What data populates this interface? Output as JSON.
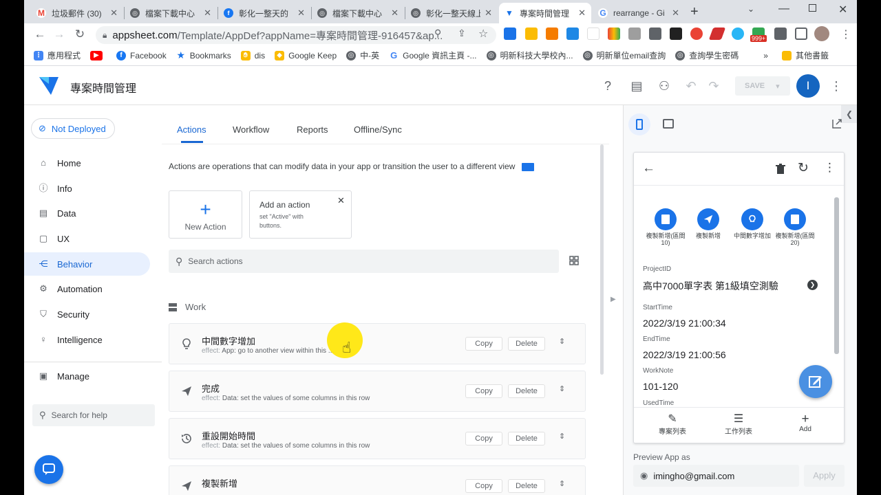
{
  "browser": {
    "tabs": [
      {
        "title": "垃圾郵件 (30)",
        "icon": "gmail-icon",
        "color": "#ea4335",
        "glyph": "M"
      },
      {
        "title": "檔案下載中心",
        "icon": "globe-icon",
        "color": "#5f6368",
        "glyph": "◎"
      },
      {
        "title": "彰化一整天的",
        "icon": "facebook-icon",
        "color": "#1877f2",
        "glyph": "f"
      },
      {
        "title": "檔案下載中心",
        "icon": "globe-icon",
        "color": "#5f6368",
        "glyph": "◎"
      },
      {
        "title": "彰化一整天線上",
        "icon": "globe-icon",
        "color": "#5f6368",
        "glyph": "◎"
      },
      {
        "title": "專案時間管理",
        "icon": "appsheet-icon",
        "color": "#1a73e8",
        "glyph": "▼"
      },
      {
        "title": "rearrange - Gi",
        "icon": "google-icon",
        "color": "#4285f4",
        "glyph": "G"
      }
    ],
    "url_main": "appsheet.com",
    "url_rest": "/Template/AppDef?appName=專案時間管理-916457&ap...",
    "bookmarks": [
      {
        "label": "應用程式",
        "color": "#4285f4",
        "glyph": "⋮"
      },
      {
        "label": "",
        "color": "#ff0000",
        "glyph": "▶"
      },
      {
        "label": "Facebook",
        "color": "#1877f2",
        "glyph": "f"
      },
      {
        "label": "Bookmarks",
        "color": "#1a73e8",
        "glyph": "★"
      },
      {
        "label": "dis",
        "color": "#fbbc04",
        "glyph": "✋"
      },
      {
        "label": "Google Keep",
        "color": "#fbbc04",
        "glyph": "◆"
      },
      {
        "label": "中-英",
        "color": "#5f6368",
        "glyph": "◎"
      },
      {
        "label": "Google 資訊主頁 -...",
        "color": "#4285f4",
        "glyph": "G"
      },
      {
        "label": "明新科技大學校內...",
        "color": "#5f6368",
        "glyph": "◎"
      },
      {
        "label": "明新單位email查詢",
        "color": "#5f6368",
        "glyph": "◎"
      },
      {
        "label": "查詢學生密碼",
        "color": "#5f6368",
        "glyph": "◎"
      }
    ],
    "bookmarks_more": "»",
    "other_bookmarks": "其他書籤",
    "ext_badge": "999+"
  },
  "app": {
    "title": "專案時間管理",
    "save_label": "SAVE",
    "avatar_letter": "I",
    "accent": "#1a73e8"
  },
  "sidebar": {
    "deploy_status": "Not Deployed",
    "items": [
      {
        "label": "Home",
        "icon": "home-icon",
        "glyph": "⌂"
      },
      {
        "label": "Info",
        "icon": "info-icon",
        "glyph": "ⓘ"
      },
      {
        "label": "Data",
        "icon": "data-icon",
        "glyph": "▤"
      },
      {
        "label": "UX",
        "icon": "ux-icon",
        "glyph": "▢"
      },
      {
        "label": "Behavior",
        "icon": "behavior-icon",
        "glyph": "⋲"
      },
      {
        "label": "Automation",
        "icon": "automation-icon",
        "glyph": "⚙"
      },
      {
        "label": "Security",
        "icon": "shield-icon",
        "glyph": "⛉"
      },
      {
        "label": "Intelligence",
        "icon": "bulb-icon",
        "glyph": "♀"
      }
    ],
    "manage_label": "Manage",
    "help_placeholder": "Search for help"
  },
  "main": {
    "tabs": [
      "Actions",
      "Workflow",
      "Reports",
      "Offline/Sync"
    ],
    "description": "Actions are operations that can modify data in your app or transition the user to a different view",
    "new_action": "New Action",
    "add_title": "Add an action",
    "add_sub": "set \"Active\" with buttons.",
    "search_placeholder": "Search actions",
    "group_label": "Work",
    "effect_label": "effect:",
    "copy_label": "Copy",
    "delete_label": "Delete",
    "actions": [
      {
        "name": "中間數字增加",
        "effect": "App: go to another view within this ...",
        "icon": "bulb-icon"
      },
      {
        "name": "完成",
        "effect": "Data: set the values of some columns in this row",
        "icon": "send-icon"
      },
      {
        "name": "重設開始時間",
        "effect": "Data: set the values of some columns in this row",
        "icon": "history-icon"
      },
      {
        "name": "複製新增",
        "effect": "",
        "icon": "send-icon"
      }
    ]
  },
  "preview": {
    "buttons": [
      "複製新增(區間10)",
      "複製新增",
      "中間數字增加",
      "複製新增(區間20)"
    ],
    "fields": [
      {
        "key": "ProjectID",
        "value": "高中7000單字表 第1級填空測驗"
      },
      {
        "key": "StartTime",
        "value": "2022/3/19 21:00:34"
      },
      {
        "key": "EndTime",
        "value": "2022/3/19 21:00:56"
      },
      {
        "key": "WorkNote",
        "value": "101-120"
      },
      {
        "key": "UsedTime",
        "value": ""
      }
    ],
    "nav": [
      "專案列表",
      "工作列表",
      "Add"
    ],
    "preview_as": "Preview App as",
    "email": "imingho@gmail.com",
    "apply": "Apply"
  }
}
